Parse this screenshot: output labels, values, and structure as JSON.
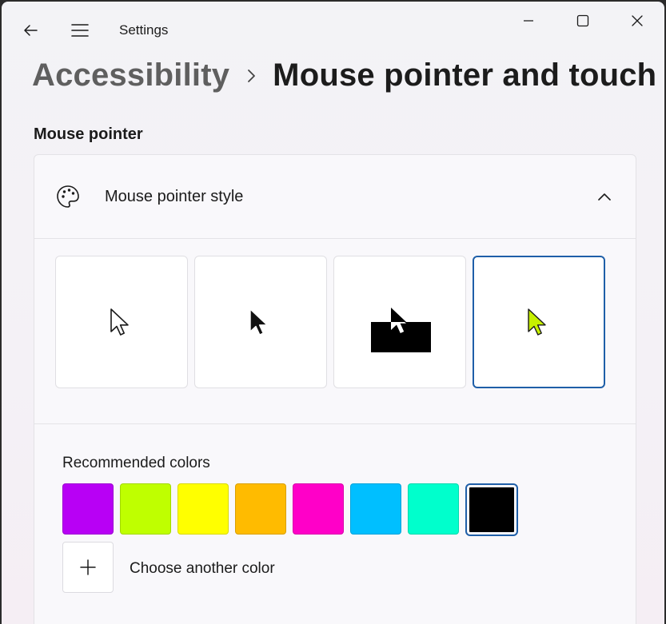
{
  "window": {
    "app_title": "Settings"
  },
  "breadcrumb": {
    "parent": "Accessibility",
    "current": "Mouse pointer and touch"
  },
  "section": {
    "title": "Mouse pointer"
  },
  "pointer_style": {
    "label": "Mouse pointer style",
    "options": [
      {
        "name": "white",
        "selected": false
      },
      {
        "name": "black",
        "selected": false
      },
      {
        "name": "inverted",
        "selected": false
      },
      {
        "name": "custom",
        "selected": true,
        "color": "#c6f000"
      }
    ]
  },
  "colors": {
    "title": "Recommended colors",
    "swatches": [
      {
        "color": "#b800f5",
        "selected": false
      },
      {
        "color": "#bfff00",
        "selected": false
      },
      {
        "color": "#ffff00",
        "selected": false
      },
      {
        "color": "#ffbb00",
        "selected": false
      },
      {
        "color": "#ff00c8",
        "selected": false
      },
      {
        "color": "#00bfff",
        "selected": false
      },
      {
        "color": "#00ffcc",
        "selected": false
      },
      {
        "color": "#000000",
        "selected": true
      }
    ],
    "add_label": "Choose another color"
  },
  "icons": {
    "back": "back-arrow-icon",
    "menu": "hamburger-menu-icon",
    "minimize": "minimize-icon",
    "maximize": "maximize-icon",
    "close": "close-icon",
    "breadcrumb_separator": "chevron-right-icon",
    "style": "palette-icon",
    "collapse": "chevron-up-icon",
    "add": "plus-icon"
  },
  "accent_color": "#1f5fa8"
}
